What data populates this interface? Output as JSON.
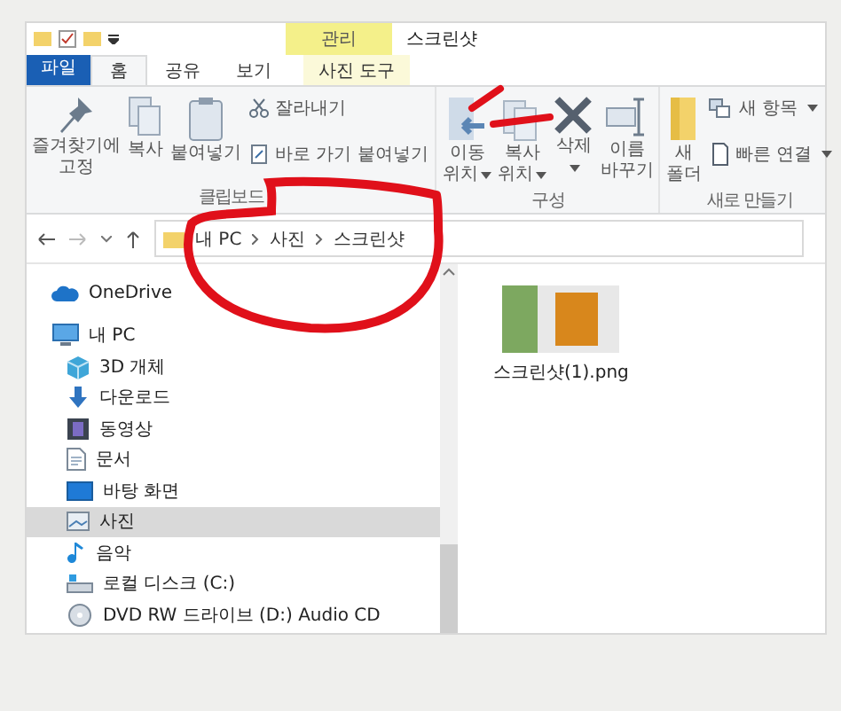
{
  "window": {
    "title": "스크린샷",
    "context_tab": "관리"
  },
  "tabs": [
    {
      "label": "파일",
      "kind": "file",
      "selected": false
    },
    {
      "label": "홈",
      "kind": "normal",
      "selected": true
    },
    {
      "label": "공유",
      "kind": "normal",
      "selected": false
    },
    {
      "label": "보기",
      "kind": "normal",
      "selected": false
    },
    {
      "label": "사진 도구",
      "kind": "context",
      "selected": false
    }
  ],
  "ribbon": {
    "groups": [
      {
        "label": "클립보드",
        "buttons": [
          {
            "kind": "pin",
            "lines": [
              "즐겨찾기에",
              "고정"
            ],
            "dropdown": false
          },
          {
            "kind": "copy",
            "lines": [
              "복사"
            ],
            "dropdown": false
          },
          {
            "kind": "paste",
            "lines": [
              "붙여넣기"
            ],
            "dropdown": false
          }
        ],
        "small": [
          {
            "kind": "cut",
            "label": "잘라내기",
            "dropdown": false
          },
          {
            "kind": "shortcut",
            "label": "바로 가기 붙여넣기",
            "dropdown": false
          }
        ]
      },
      {
        "label": "구성",
        "buttons": [
          {
            "kind": "move",
            "lines": [
              "이동",
              "위치"
            ],
            "dropdown": true
          },
          {
            "kind": "copyto",
            "lines": [
              "복사",
              "위치"
            ],
            "dropdown": true
          },
          {
            "kind": "delete",
            "lines": [
              "삭제"
            ],
            "dropdown": true
          },
          {
            "kind": "rename",
            "lines": [
              "이름",
              "바꾸기"
            ],
            "dropdown": false
          }
        ]
      },
      {
        "label": "새로 만들기",
        "buttons": [
          {
            "kind": "folder",
            "lines": [
              "새",
              "폴더"
            ],
            "dropdown": false
          }
        ],
        "small": [
          {
            "kind": "newitem",
            "label": "새 항목",
            "dropdown": true
          },
          {
            "kind": "easy",
            "label": "빠른 연결",
            "dropdown": true
          }
        ]
      }
    ]
  },
  "address": {
    "path": [
      "내 PC",
      "사진",
      "스크린샷"
    ]
  },
  "navigation": [
    {
      "label": "OneDrive",
      "kind": "cloud",
      "selected": false
    },
    {
      "label": "내 PC",
      "kind": "pc",
      "selected": false,
      "children": [
        {
          "label": "3D 개체",
          "kind": "cube",
          "selected": false
        },
        {
          "label": "다운로드",
          "kind": "download",
          "selected": false
        },
        {
          "label": "동영상",
          "kind": "video",
          "selected": false
        },
        {
          "label": "문서",
          "kind": "doc",
          "selected": false
        },
        {
          "label": "바탕 화면",
          "kind": "desktop",
          "selected": false
        },
        {
          "label": "사진",
          "kind": "picture",
          "selected": true
        },
        {
          "label": "음악",
          "kind": "music",
          "selected": false
        },
        {
          "label": "로컬 디스크 (C:)",
          "kind": "disk",
          "selected": false
        },
        {
          "label": "DVD RW 드라이브 (D:) Audio CD",
          "kind": "dvd",
          "selected": false
        }
      ]
    }
  ],
  "files": [
    {
      "name": "스크린샷(1).png"
    }
  ]
}
